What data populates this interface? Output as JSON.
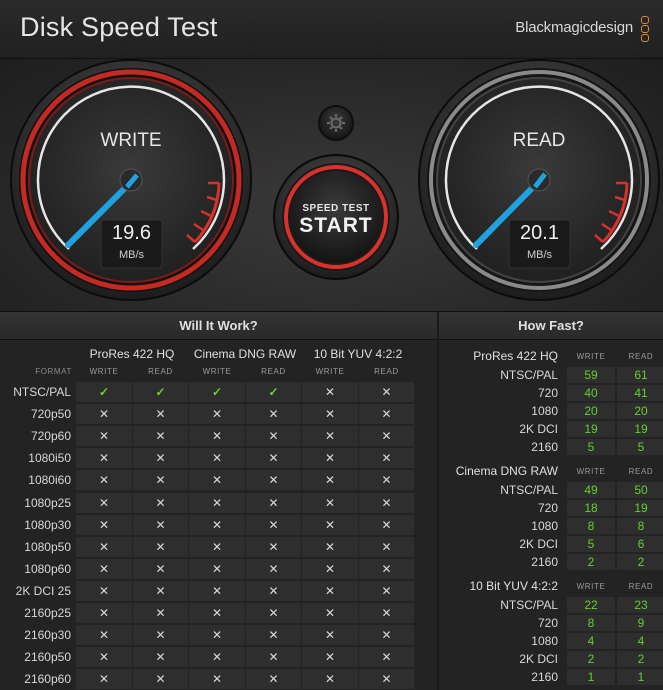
{
  "app": {
    "title": "Disk Speed Test",
    "brand": "Blackmagicdesign"
  },
  "write_gauge": {
    "label": "WRITE",
    "value": "19.6",
    "unit": "MB/s"
  },
  "read_gauge": {
    "label": "READ",
    "value": "20.1",
    "unit": "MB/s"
  },
  "start_button": {
    "line1": "SPEED TEST",
    "line2": "START"
  },
  "icons": {
    "settings": "gear-icon"
  },
  "colors": {
    "needle": "#1fa3e0",
    "ok": "#6fcf2a",
    "speed_value": "#63d12a",
    "warning_arc": "#d8322a",
    "brand_logo": "#d98b3a"
  },
  "will_it_work": {
    "title": "Will It Work?",
    "format_header": "FORMAT",
    "write_label": "WRITE",
    "read_label": "READ",
    "columns": [
      "ProRes 422 HQ",
      "Cinema DNG RAW",
      "10 Bit YUV 4:2:2"
    ],
    "rows": [
      {
        "format": "NTSC/PAL",
        "cells": [
          "✓",
          "✓",
          "✓",
          "✓",
          "✕",
          "✕"
        ]
      },
      {
        "format": "720p50",
        "cells": [
          "✕",
          "✕",
          "✕",
          "✕",
          "✕",
          "✕"
        ]
      },
      {
        "format": "720p60",
        "cells": [
          "✕",
          "✕",
          "✕",
          "✕",
          "✕",
          "✕"
        ]
      },
      {
        "format": "1080i50",
        "cells": [
          "✕",
          "✕",
          "✕",
          "✕",
          "✕",
          "✕"
        ]
      },
      {
        "format": "1080i60",
        "cells": [
          "✕",
          "✕",
          "✕",
          "✕",
          "✕",
          "✕"
        ]
      },
      {
        "format": "1080p25",
        "cells": [
          "✕",
          "✕",
          "✕",
          "✕",
          "✕",
          "✕"
        ]
      },
      {
        "format": "1080p30",
        "cells": [
          "✕",
          "✕",
          "✕",
          "✕",
          "✕",
          "✕"
        ]
      },
      {
        "format": "1080p50",
        "cells": [
          "✕",
          "✕",
          "✕",
          "✕",
          "✕",
          "✕"
        ]
      },
      {
        "format": "1080p60",
        "cells": [
          "✕",
          "✕",
          "✕",
          "✕",
          "✕",
          "✕"
        ]
      },
      {
        "format": "2K DCI 25",
        "cells": [
          "✕",
          "✕",
          "✕",
          "✕",
          "✕",
          "✕"
        ]
      },
      {
        "format": "2160p25",
        "cells": [
          "✕",
          "✕",
          "✕",
          "✕",
          "✕",
          "✕"
        ]
      },
      {
        "format": "2160p30",
        "cells": [
          "✕",
          "✕",
          "✕",
          "✕",
          "✕",
          "✕"
        ]
      },
      {
        "format": "2160p50",
        "cells": [
          "✕",
          "✕",
          "✕",
          "✕",
          "✕",
          "✕"
        ]
      },
      {
        "format": "2160p60",
        "cells": [
          "✕",
          "✕",
          "✕",
          "✕",
          "✕",
          "✕"
        ]
      }
    ]
  },
  "how_fast": {
    "title": "How Fast?",
    "write_label": "WRITE",
    "read_label": "READ",
    "groups": [
      {
        "name": "ProRes 422 HQ",
        "rows": [
          {
            "format": "NTSC/PAL",
            "write": "59",
            "read": "61"
          },
          {
            "format": "720",
            "write": "40",
            "read": "41"
          },
          {
            "format": "1080",
            "write": "20",
            "read": "20"
          },
          {
            "format": "2K DCI",
            "write": "19",
            "read": "19"
          },
          {
            "format": "2160",
            "write": "5",
            "read": "5"
          }
        ]
      },
      {
        "name": "Cinema DNG RAW",
        "rows": [
          {
            "format": "NTSC/PAL",
            "write": "49",
            "read": "50"
          },
          {
            "format": "720",
            "write": "18",
            "read": "19"
          },
          {
            "format": "1080",
            "write": "8",
            "read": "8"
          },
          {
            "format": "2K DCI",
            "write": "5",
            "read": "6"
          },
          {
            "format": "2160",
            "write": "2",
            "read": "2"
          }
        ]
      },
      {
        "name": "10 Bit YUV 4:2:2",
        "rows": [
          {
            "format": "NTSC/PAL",
            "write": "22",
            "read": "23"
          },
          {
            "format": "720",
            "write": "8",
            "read": "9"
          },
          {
            "format": "1080",
            "write": "4",
            "read": "4"
          },
          {
            "format": "2K DCI",
            "write": "2",
            "read": "2"
          },
          {
            "format": "2160",
            "write": "1",
            "read": "1"
          }
        ]
      }
    ]
  }
}
